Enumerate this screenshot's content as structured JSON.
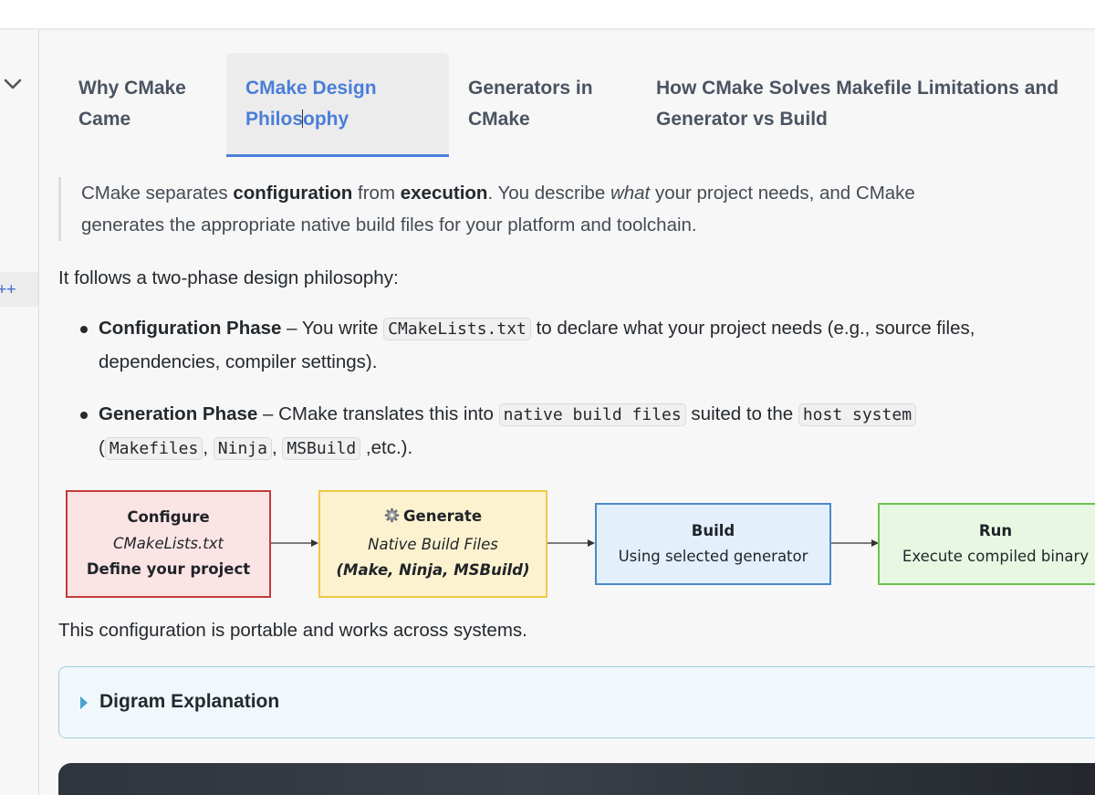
{
  "tabs": [
    {
      "line1": "Why CMake",
      "line2": "Came",
      "active": false
    },
    {
      "line1": "CMake Design",
      "line2a": "Philos",
      "line2b": "ophy",
      "active": true
    },
    {
      "line1": "Generators in",
      "line2": "CMake",
      "active": false
    },
    {
      "line1": "How CMake Solves Makefile Limitations and",
      "line2": "Generator vs Build",
      "active": false
    }
  ],
  "sidebar": {
    "plus_label": "++"
  },
  "quote": {
    "p1": "CMake separates ",
    "b1": "configuration",
    "p2": " from ",
    "b2": "execution",
    "p3": ". You describe ",
    "em": "what",
    "p4": " your project needs, and CMake generates the appropriate native build files for your platform and toolchain."
  },
  "intro": "It follows a two-phase design philosophy:",
  "bullets": {
    "config": {
      "title": "Configuration Phase",
      "dash": " – You write ",
      "code": "CMakeLists.txt",
      "rest": " to declare what your project needs (e.g., source files, dependencies, compiler settings)."
    },
    "gen": {
      "title": "Generation Phase",
      "dash": " – CMake translates this into ",
      "code1": "native build files",
      "mid": " suited to the ",
      "code2": "host system",
      "open": " (",
      "code3": "Makefiles",
      "comma1": ", ",
      "code4": "Ninja",
      "comma2": ", ",
      "code5": "MSBuild",
      "tail": " ,etc.)."
    }
  },
  "diagram": {
    "configure": {
      "title": "Configure",
      "line2": "CMakeLists.txt",
      "line3": "Define your project"
    },
    "generate": {
      "icon": "gear-icon",
      "title": "Generate",
      "line2": "Native Build Files",
      "line3": "(Make, Ninja, MSBuild)"
    },
    "build": {
      "title": "Build",
      "line2": "Using selected generator"
    },
    "run": {
      "title": "Run",
      "line2": "Execute compiled binary"
    }
  },
  "outro": "This configuration is portable and works across systems.",
  "details": {
    "label": "Digram Explanation"
  },
  "colors": {
    "accent": "#4a7ed8",
    "configure_fill": "#fbe4e4",
    "configure_border": "#c43b3b",
    "generate_fill": "#fdf2cf",
    "generate_border": "#efc74a",
    "build_fill": "#e3effb",
    "build_border": "#4b89c6",
    "run_fill": "#e7f7e2",
    "run_border": "#6cc34e",
    "details_fill": "#f0f8fb",
    "details_border": "#9cd0e3"
  }
}
